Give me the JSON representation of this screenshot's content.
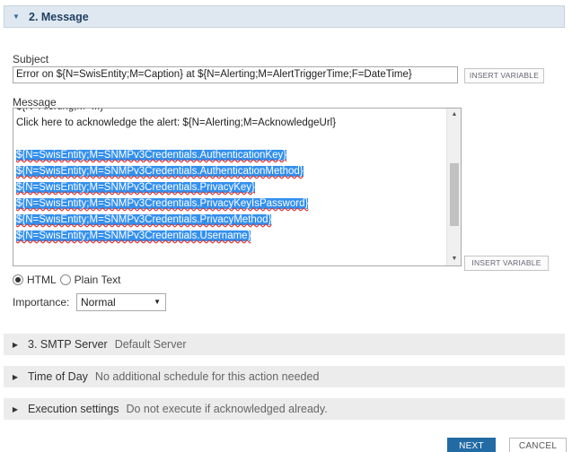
{
  "message_section": {
    "title": "2. Message",
    "subject_label": "Subject",
    "subject_value": "Error on ${N=SwisEntity;M=Caption} at ${N=Alerting;M=AlertTriggerTime;F=DateTime}",
    "insert_variable_label": "INSERT VARIABLE",
    "message_label": "Message",
    "message_lines": [
      "${N=Alerting;M=...}",
      "Click here to acknowledge the alert: ${N=Alerting;M=AcknowledgeUrl}",
      "",
      "${N=SwisEntity;M=SNMPv3Credentials.AuthenticationKey}",
      "${N=SwisEntity;M=SNMPv3Credentials.AuthenticationMethod}",
      "${N=SwisEntity;M=SNMPv3Credentials.PrivacyKey}",
      "${N=SwisEntity;M=SNMPv3Credentials.PrivacyKeyIsPassword}",
      "${N=SwisEntity;M=SNMPv3Credentials.PrivacyMethod}",
      "${N=SwisEntity;M=SNMPv3Credentials.Username}"
    ],
    "format_options": [
      "HTML",
      "Plain Text"
    ],
    "selected_format": "HTML",
    "importance_label": "Importance:",
    "importance_value": "Normal"
  },
  "collapsed_sections": [
    {
      "title": "3. SMTP Server",
      "subtitle": "Default Server"
    },
    {
      "title": "Time of Day",
      "subtitle": "No additional schedule for this action needed"
    },
    {
      "title": "Execution settings",
      "subtitle": "Do not execute if acknowledged already."
    }
  ],
  "footer": {
    "next_label": "NEXT",
    "cancel_label": "CANCEL"
  },
  "icons": {
    "expanded": "caret-down-icon",
    "collapsed": "caret-right-icon",
    "scroll_up": "scroll-up-arrow-icon",
    "scroll_down": "scroll-down-arrow-icon",
    "dropdown": "dropdown-arrow-icon"
  },
  "colors": {
    "selection": "#3390ee",
    "primary_button": "#236ba4",
    "active_header": "#dfe8f1",
    "collapsed_header": "#ececec"
  }
}
